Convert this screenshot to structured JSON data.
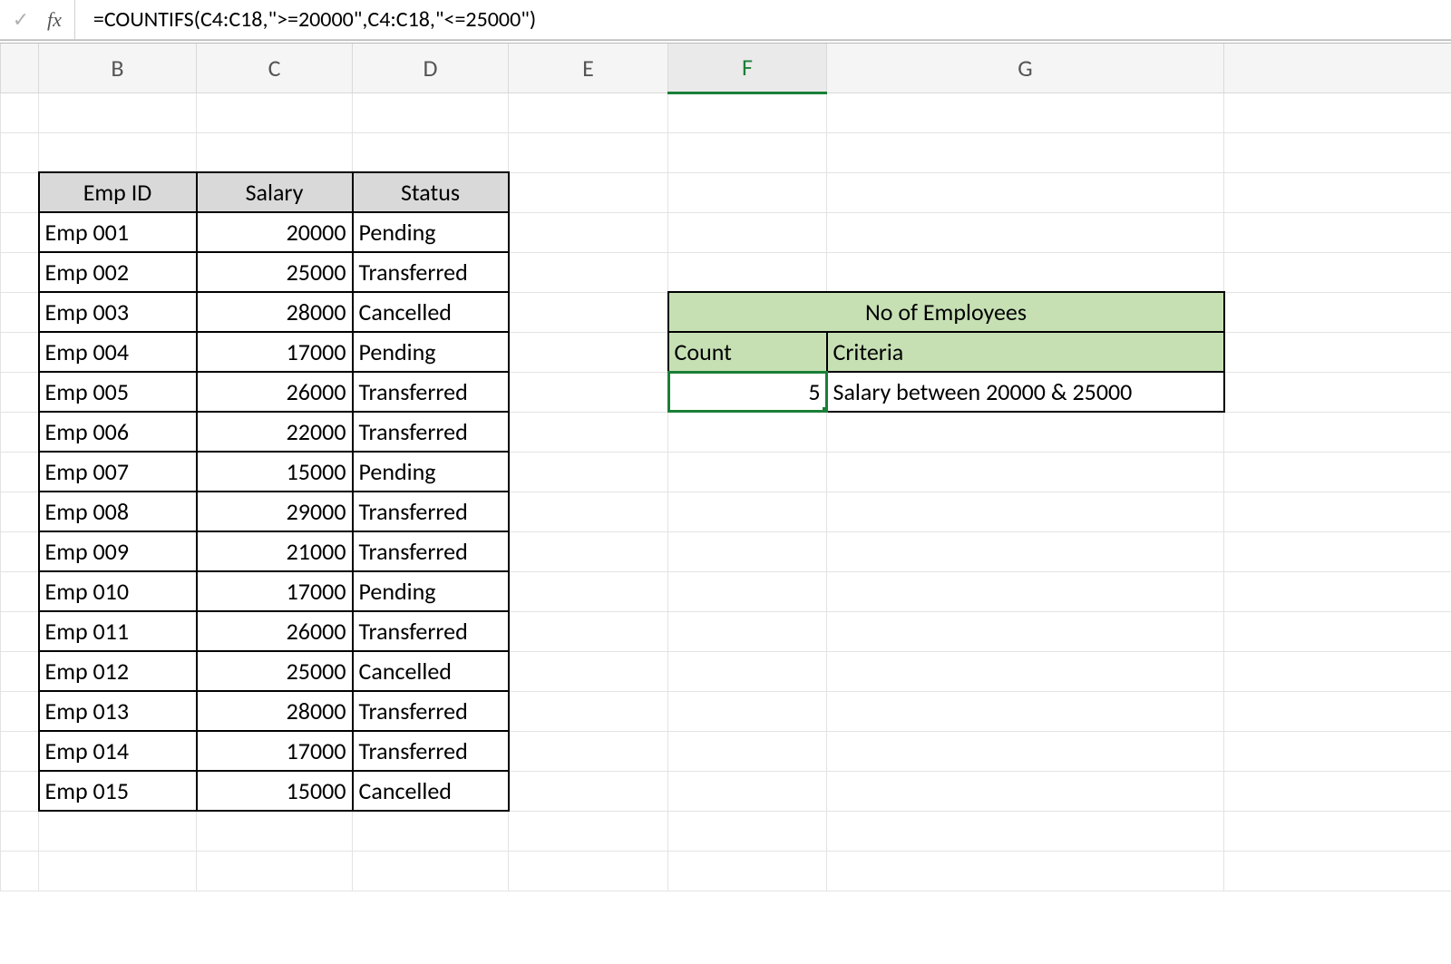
{
  "formula_bar": {
    "fx_label": "fx",
    "formula": "=COUNTIFS(C4:C18,\">=20000\",C4:C18,\"<=25000\")"
  },
  "columns": [
    "B",
    "C",
    "D",
    "E",
    "F",
    "G"
  ],
  "active_column": "F",
  "emp_table": {
    "headers": [
      "Emp ID",
      "Salary",
      "Status"
    ],
    "rows": [
      {
        "id": "Emp 001",
        "salary": "20000",
        "status": "Pending"
      },
      {
        "id": "Emp 002",
        "salary": "25000",
        "status": "Transferred"
      },
      {
        "id": "Emp 003",
        "salary": "28000",
        "status": "Cancelled"
      },
      {
        "id": "Emp 004",
        "salary": "17000",
        "status": "Pending"
      },
      {
        "id": "Emp 005",
        "salary": "26000",
        "status": "Transferred"
      },
      {
        "id": "Emp 006",
        "salary": "22000",
        "status": "Transferred"
      },
      {
        "id": "Emp 007",
        "salary": "15000",
        "status": "Pending"
      },
      {
        "id": "Emp 008",
        "salary": "29000",
        "status": "Transferred"
      },
      {
        "id": "Emp 009",
        "salary": "21000",
        "status": "Transferred"
      },
      {
        "id": "Emp 010",
        "salary": "17000",
        "status": "Pending"
      },
      {
        "id": "Emp 011",
        "salary": "26000",
        "status": "Transferred"
      },
      {
        "id": "Emp 012",
        "salary": "25000",
        "status": "Cancelled"
      },
      {
        "id": "Emp 013",
        "salary": "28000",
        "status": "Transferred"
      },
      {
        "id": "Emp 014",
        "salary": "17000",
        "status": "Transferred"
      },
      {
        "id": "Emp 015",
        "salary": "15000",
        "status": "Cancelled"
      }
    ]
  },
  "summary": {
    "title": "No of Employees",
    "count_label": "Count",
    "criteria_label": "Criteria",
    "count_value": "5",
    "criteria_value": "Salary between 20000 & 25000"
  }
}
